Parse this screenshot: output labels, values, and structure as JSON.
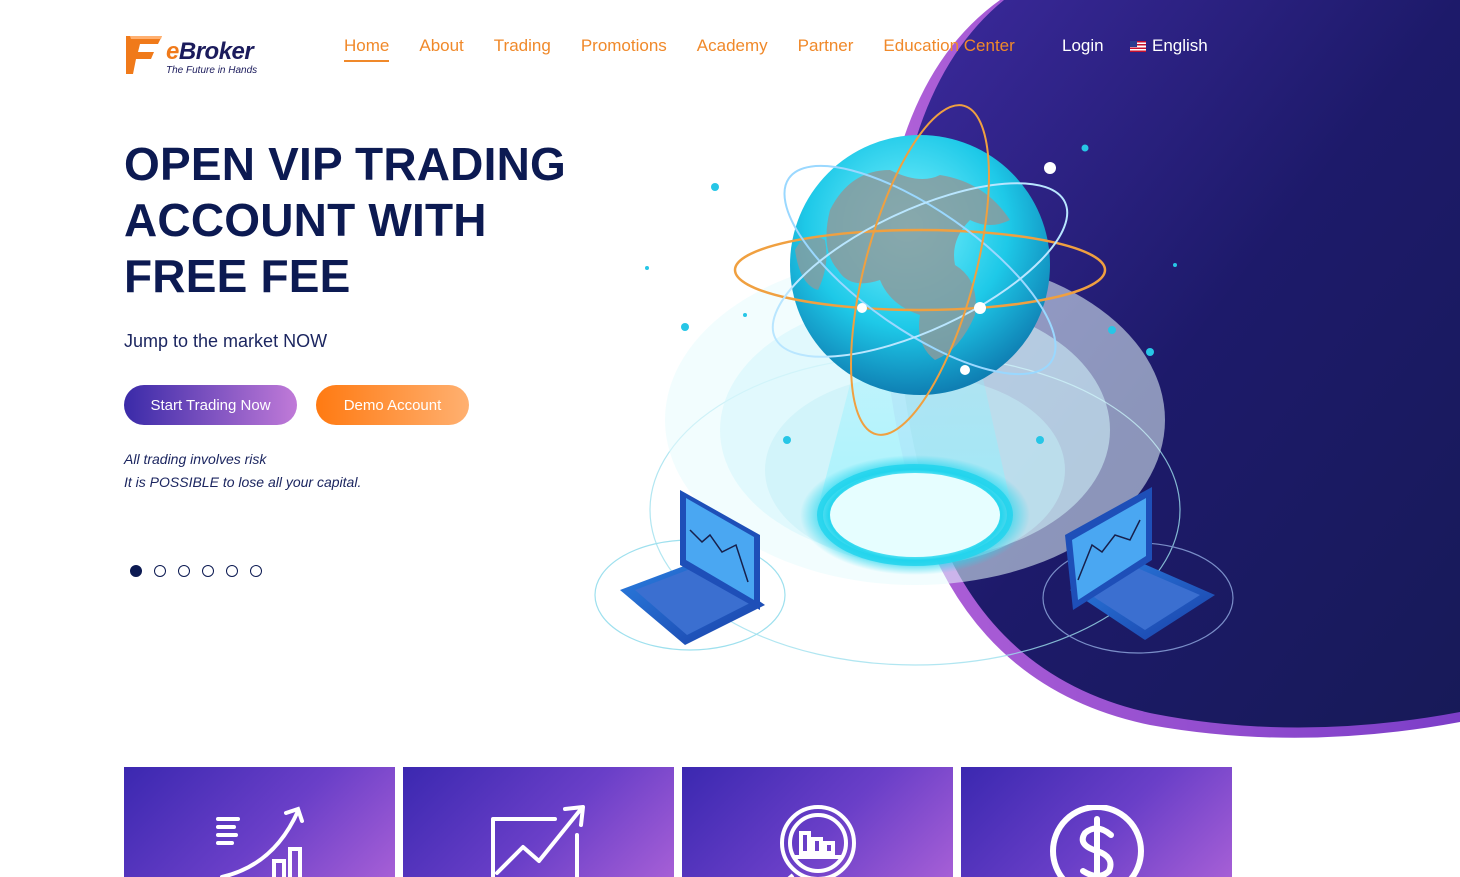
{
  "brand": {
    "name_prefix": "e",
    "name_suffix": "Broker",
    "tagline": "The Future in Hands",
    "accent_color": "#f0892a",
    "primary_color": "#0c1a52"
  },
  "nav": {
    "items": [
      {
        "label": "Home",
        "active": true
      },
      {
        "label": "About"
      },
      {
        "label": "Trading"
      },
      {
        "label": "Promotions"
      },
      {
        "label": "Academy"
      },
      {
        "label": "Partner"
      },
      {
        "label": "Education Center"
      }
    ],
    "login_label": "Login",
    "language_label": "English",
    "language_icon": "us-flag-icon"
  },
  "hero": {
    "title": "OPEN VIP TRADING ACCOUNT WITH FREE FEE",
    "subtitle": "Jump to the market NOW",
    "primary_button": "Start Trading Now",
    "secondary_button": "Demo Account",
    "risk_line1": "All trading involves risk",
    "risk_line2": "It is POSSIBLE to lose all your capital.",
    "slides_count": 6,
    "active_slide": 1
  },
  "features": [
    {
      "icon": "growth-chart-icon"
    },
    {
      "icon": "trend-up-icon"
    },
    {
      "icon": "analytics-magnifier-icon"
    },
    {
      "icon": "dollar-coin-icon"
    }
  ]
}
